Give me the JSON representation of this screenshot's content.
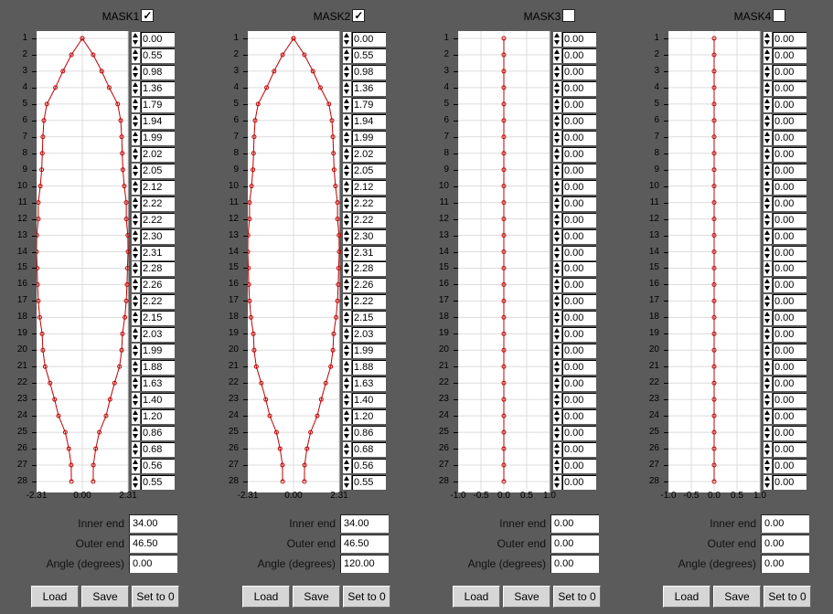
{
  "masks": [
    {
      "title": "MASK1",
      "checked": true,
      "check_glyph": "✓",
      "x_ticks": [
        "-2.31",
        "0.00",
        "2.31"
      ],
      "xlim": [
        -2.31,
        2.31
      ],
      "x_tick_values": [
        -2.31,
        0,
        2.31
      ],
      "values": [
        "0.00",
        "0.55",
        "0.98",
        "1.36",
        "1.79",
        "1.94",
        "1.99",
        "2.02",
        "2.05",
        "2.12",
        "2.22",
        "2.22",
        "2.30",
        "2.31",
        "2.28",
        "2.26",
        "2.22",
        "2.15",
        "2.03",
        "1.99",
        "1.88",
        "1.63",
        "1.40",
        "1.20",
        "0.86",
        "0.68",
        "0.56",
        "0.55"
      ],
      "mirrored": true,
      "params": [
        {
          "label": "Inner end",
          "value": "34.00"
        },
        {
          "label": "Outer end",
          "value": "46.50"
        },
        {
          "label": "Angle (degrees)",
          "value": "0.00"
        }
      ],
      "buttons": {
        "load": "Load",
        "save": "Save",
        "zero": "Set to 0"
      }
    },
    {
      "title": "MASK2",
      "checked": true,
      "check_glyph": "✓",
      "x_ticks": [
        "-2.31",
        "0.00",
        "2.31"
      ],
      "xlim": [
        -2.31,
        2.31
      ],
      "x_tick_values": [
        -2.31,
        0,
        2.31
      ],
      "values": [
        "0.00",
        "0.55",
        "0.98",
        "1.36",
        "1.79",
        "1.94",
        "1.99",
        "2.02",
        "2.05",
        "2.12",
        "2.22",
        "2.22",
        "2.30",
        "2.31",
        "2.28",
        "2.26",
        "2.22",
        "2.15",
        "2.03",
        "1.99",
        "1.88",
        "1.63",
        "1.40",
        "1.20",
        "0.86",
        "0.68",
        "0.56",
        "0.55"
      ],
      "mirrored": true,
      "params": [
        {
          "label": "Inner end",
          "value": "34.00"
        },
        {
          "label": "Outer end",
          "value": "46.50"
        },
        {
          "label": "Angle (degrees)",
          "value": "120.00"
        }
      ],
      "buttons": {
        "load": "Load",
        "save": "Save",
        "zero": "Set to 0"
      }
    },
    {
      "title": "MASK3",
      "checked": false,
      "check_glyph": "",
      "x_ticks": [
        "-1.0",
        "-0.5",
        "0.0",
        "0.5",
        "1.0"
      ],
      "xlim": [
        -1,
        1
      ],
      "x_tick_values": [
        -1,
        -0.5,
        0,
        0.5,
        1
      ],
      "values": [
        "0.00",
        "0.00",
        "0.00",
        "0.00",
        "0.00",
        "0.00",
        "0.00",
        "0.00",
        "0.00",
        "0.00",
        "0.00",
        "0.00",
        "0.00",
        "0.00",
        "0.00",
        "0.00",
        "0.00",
        "0.00",
        "0.00",
        "0.00",
        "0.00",
        "0.00",
        "0.00",
        "0.00",
        "0.00",
        "0.00",
        "0.00",
        "0.00"
      ],
      "mirrored": false,
      "params": [
        {
          "label": "Inner end",
          "value": "0.00"
        },
        {
          "label": "Outer end",
          "value": "0.00"
        },
        {
          "label": "Angle (degrees)",
          "value": "0.00"
        }
      ],
      "buttons": {
        "load": "Load",
        "save": "Save",
        "zero": "Set to 0"
      }
    },
    {
      "title": "MASK4",
      "checked": false,
      "check_glyph": "",
      "x_ticks": [
        "-1.0",
        "-0.5",
        "0.0",
        "0.5",
        "1.0"
      ],
      "xlim": [
        -1,
        1
      ],
      "x_tick_values": [
        -1,
        -0.5,
        0,
        0.5,
        1
      ],
      "values": [
        "0.00",
        "0.00",
        "0.00",
        "0.00",
        "0.00",
        "0.00",
        "0.00",
        "0.00",
        "0.00",
        "0.00",
        "0.00",
        "0.00",
        "0.00",
        "0.00",
        "0.00",
        "0.00",
        "0.00",
        "0.00",
        "0.00",
        "0.00",
        "0.00",
        "0.00",
        "0.00",
        "0.00",
        "0.00",
        "0.00",
        "0.00",
        "0.00"
      ],
      "mirrored": false,
      "params": [
        {
          "label": "Inner end",
          "value": "0.00"
        },
        {
          "label": "Outer end",
          "value": "0.00"
        },
        {
          "label": "Angle (degrees)",
          "value": "0.00"
        }
      ],
      "buttons": {
        "load": "Load",
        "save": "Save",
        "zero": "Set to 0"
      }
    }
  ],
  "y_ticks": [
    "1",
    "2",
    "3",
    "4",
    "5",
    "6",
    "7",
    "8",
    "9",
    "10",
    "11",
    "12",
    "13",
    "14",
    "15",
    "16",
    "17",
    "18",
    "19",
    "20",
    "21",
    "22",
    "23",
    "24",
    "25",
    "26",
    "27",
    "28"
  ],
  "colors": {
    "curve": "#c00000",
    "plot_bg": "#ffffff",
    "grid": "#dcdcdc",
    "app_bg": "#5b5b5b"
  }
}
